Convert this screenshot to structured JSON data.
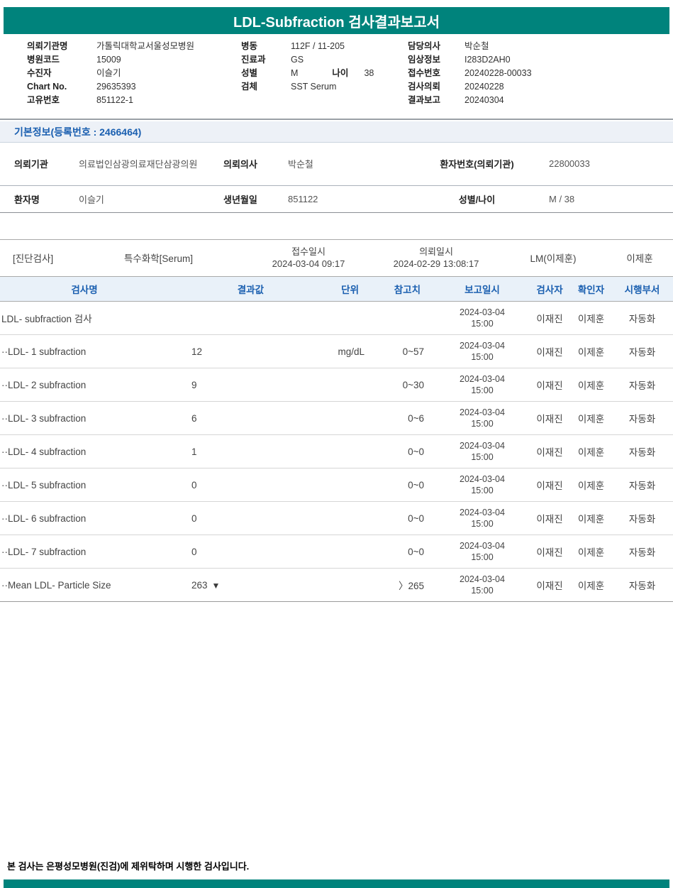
{
  "report": {
    "title": "LDL-Subfraction 검사결과보고서"
  },
  "colors": {
    "teal": "#00837C",
    "header_blue": "#1A5FB0",
    "header_bg": "#E9F1F9"
  },
  "top_info": {
    "left": [
      {
        "label": "의뢰기관명",
        "value": "가톨릭대학교서울성모병원"
      },
      {
        "label": "병원코드",
        "value": "15009"
      },
      {
        "label": "수진자",
        "value": "이슬기"
      },
      {
        "label": "Chart No.",
        "value": "29635393"
      },
      {
        "label": "고유번호",
        "value": "851122-1"
      }
    ],
    "middle": [
      {
        "label": "병동",
        "value": "112F / 11-205"
      },
      {
        "label": "진료과",
        "value": "GS"
      },
      {
        "label": "성별",
        "value": "M",
        "label2": "나이",
        "value2": "38"
      },
      {
        "label": "검체",
        "value": "SST Serum"
      }
    ],
    "right": [
      {
        "label": "담당의사",
        "value": "박순철"
      },
      {
        "label": "임상정보",
        "value": "I283D2AH0"
      },
      {
        "label": "접수번호",
        "value": "20240228-00033"
      },
      {
        "label": "검사의뢰",
        "value": "20240228"
      },
      {
        "label": "결과보고",
        "value": "20240304"
      }
    ]
  },
  "basic_info": {
    "header": "기본정보(등록번호 : 2466464)",
    "row1": {
      "label1": "의뢰기관",
      "value1": "의료법인삼광의료재단삼광의원",
      "label2": "의뢰의사",
      "value2": "박순철",
      "label3": "환자번호(의뢰기관)",
      "value3": "22800033"
    },
    "row2": {
      "label1": "환자명",
      "value1": "이슬기",
      "label2": "생년월일",
      "value2": "851122",
      "label3": "성별/나이",
      "value3": "M / 38"
    }
  },
  "section_bar": {
    "category": "[진단검사]",
    "panel": "특수화학[Serum]",
    "receipt_label": "접수일시",
    "receipt_value": "2024-03-04 09:17",
    "request_label": "의뢰일시",
    "request_value": "2024-02-29 13:08:17",
    "lab": "LM(이제훈)",
    "confirmer": "이제훈"
  },
  "results_table": {
    "headers": [
      "검사명",
      "결과값",
      "단위",
      "참고치",
      "보고일시",
      "검사자",
      "확인자",
      "시행부서"
    ],
    "rows": [
      {
        "name": "LDL- subfraction 검사",
        "result": "",
        "flag": "",
        "unit": "",
        "ref": "",
        "reported_date": "2024-03-04",
        "reported_time": "15:00",
        "tester": "이재진",
        "confirmer": "이제훈",
        "dept": "자동화"
      },
      {
        "name": "··LDL- 1 subfraction",
        "result": "12",
        "flag": "",
        "unit": "mg/dL",
        "ref": "0~57",
        "reported_date": "2024-03-04",
        "reported_time": "15:00",
        "tester": "이재진",
        "confirmer": "이제훈",
        "dept": "자동화"
      },
      {
        "name": "··LDL- 2 subfraction",
        "result": "9",
        "flag": "",
        "unit": "",
        "ref": "0~30",
        "reported_date": "2024-03-04",
        "reported_time": "15:00",
        "tester": "이재진",
        "confirmer": "이제훈",
        "dept": "자동화"
      },
      {
        "name": "··LDL- 3 subfraction",
        "result": "6",
        "flag": "",
        "unit": "",
        "ref": "0~6",
        "reported_date": "2024-03-04",
        "reported_time": "15:00",
        "tester": "이재진",
        "confirmer": "이제훈",
        "dept": "자동화"
      },
      {
        "name": "··LDL- 4 subfraction",
        "result": "1",
        "flag": "",
        "unit": "",
        "ref": "0~0",
        "reported_date": "2024-03-04",
        "reported_time": "15:00",
        "tester": "이재진",
        "confirmer": "이제훈",
        "dept": "자동화"
      },
      {
        "name": "··LDL- 5 subfraction",
        "result": "0",
        "flag": "",
        "unit": "",
        "ref": "0~0",
        "reported_date": "2024-03-04",
        "reported_time": "15:00",
        "tester": "이재진",
        "confirmer": "이제훈",
        "dept": "자동화"
      },
      {
        "name": "··LDL- 6 subfraction",
        "result": "0",
        "flag": "",
        "unit": "",
        "ref": "0~0",
        "reported_date": "2024-03-04",
        "reported_time": "15:00",
        "tester": "이재진",
        "confirmer": "이제훈",
        "dept": "자동화"
      },
      {
        "name": "··LDL- 7 subfraction",
        "result": "0",
        "flag": "",
        "unit": "",
        "ref": "0~0",
        "reported_date": "2024-03-04",
        "reported_time": "15:00",
        "tester": "이재진",
        "confirmer": "이제훈",
        "dept": "자동화"
      },
      {
        "name": "··Mean LDL- Particle Size",
        "result": "263",
        "flag": "▼",
        "unit": "",
        "ref": "〉265",
        "reported_date": "2024-03-04",
        "reported_time": "15:00",
        "tester": "이재진",
        "confirmer": "이제훈",
        "dept": "자동화"
      }
    ]
  },
  "footer": {
    "note": "본 검사는 은평성모병원(진검)에 제위탁하며 시행한 검사입니다."
  }
}
